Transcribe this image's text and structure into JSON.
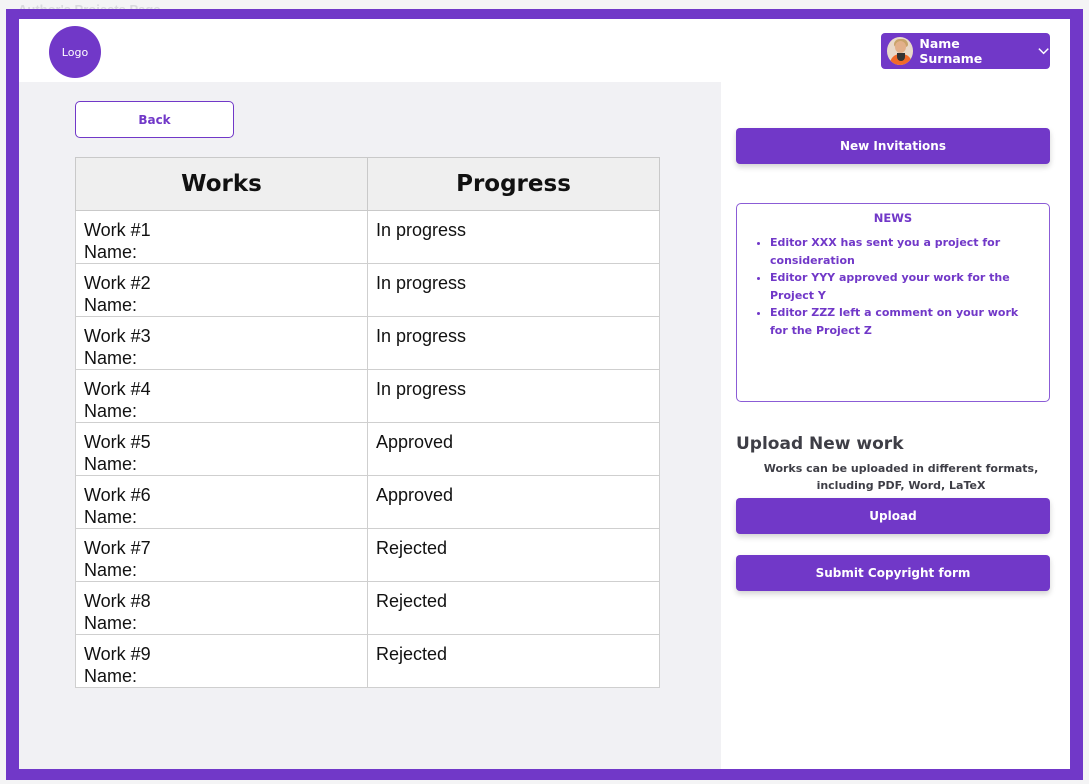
{
  "page_label": "Author's Projects Page",
  "header": {
    "logo_label": "Logo",
    "user_name": "Name Surname"
  },
  "main": {
    "back_label": "Back",
    "table": {
      "headers": [
        "Works",
        "Progress"
      ],
      "rows": [
        {
          "work": "Work #1",
          "name_label": "Name:",
          "progress": "In progress"
        },
        {
          "work": "Work #2",
          "name_label": "Name:",
          "progress": "In progress"
        },
        {
          "work": "Work #3",
          "name_label": "Name:",
          "progress": "In progress"
        },
        {
          "work": "Work #4",
          "name_label": "Name:",
          "progress": "In progress"
        },
        {
          "work": "Work #5",
          "name_label": "Name:",
          "progress": "Approved"
        },
        {
          "work": "Work #6",
          "name_label": "Name:",
          "progress": "Approved"
        },
        {
          "work": "Work #7",
          "name_label": "Name:",
          "progress": "Rejected"
        },
        {
          "work": "Work #8",
          "name_label": "Name:",
          "progress": "Rejected"
        },
        {
          "work": "Work #9",
          "name_label": "Name:",
          "progress": "Rejected"
        }
      ]
    }
  },
  "sidebar": {
    "new_invitations_label": "New Invitations",
    "news": {
      "title": "NEWS",
      "items": [
        "Editor XXX has sent you a project for consideration",
        "Editor YYY approved your work for the Project Y",
        "Editor ZZZ left a comment on your work for the Project Z"
      ]
    },
    "upload": {
      "title": "Upload New work",
      "description": "Works can be uploaded in different formats, including PDF, Word, LaTeX",
      "upload_label": "Upload",
      "copyright_label": "Submit Copyright form"
    }
  },
  "colors": {
    "accent": "#7138c8",
    "panel_bg": "#f1f1f4",
    "header_bg": "#ffffff"
  },
  "icons": [
    "chevron-down-icon",
    "avatar"
  ]
}
